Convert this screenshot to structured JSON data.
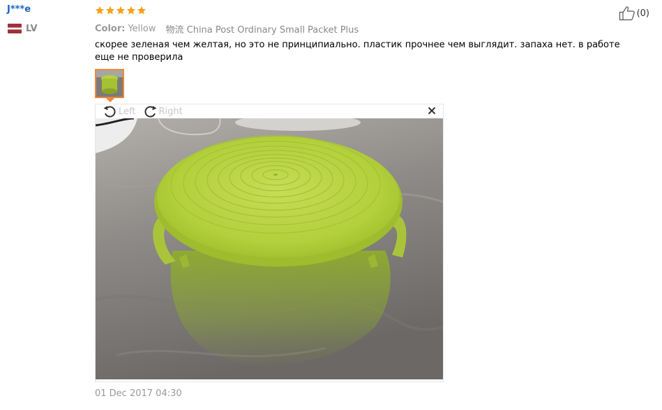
{
  "buyer": {
    "name": "J***e",
    "country_code": "LV",
    "flag_icon": "latvia-flag-icon",
    "flag_colors": [
      "#9e3039",
      "#ffffff"
    ],
    "name_color": "#1a66c0"
  },
  "helpful": {
    "icon": "thumbs-up-icon",
    "count": "(0)"
  },
  "review": {
    "rating": 5,
    "max_rating": 5,
    "star_color": "#f7a11a",
    "color_label": "Color:",
    "color_value": "Yellow",
    "logistics": "物流 China Post Ordinary Small Packet Plus",
    "text": "скорее зеленая чем желтая, но это не принципиально. пластик прочнее чем выглядит. запаха нет. в работе еще не проверила",
    "date": "01 Dec 2017 04:30"
  },
  "viewer": {
    "rotate_left_label": "Left",
    "rotate_right_label": "Right",
    "rotate_left_icon": "rotate-left-icon",
    "rotate_right_icon": "rotate-right-icon",
    "close_icon": "close-icon",
    "accent_color": "#f0883a"
  }
}
